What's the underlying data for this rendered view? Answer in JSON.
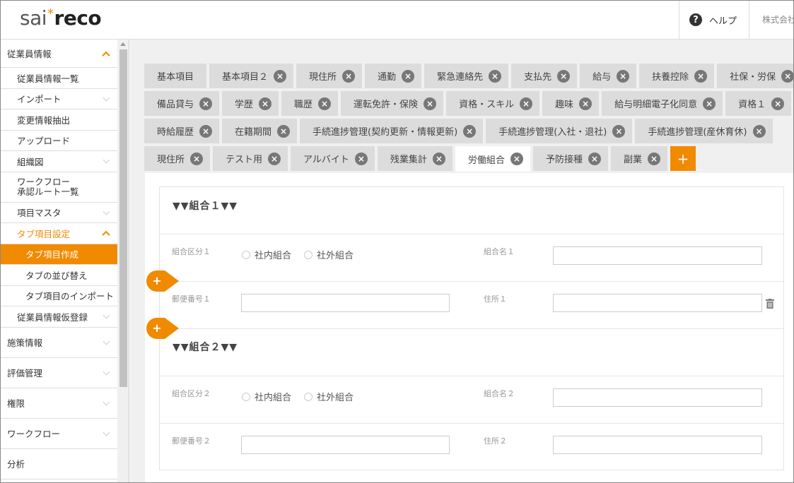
{
  "header": {
    "logo_a": "sai",
    "logo_star": "*",
    "logo_b": "reco",
    "help_icon": "question-icon",
    "help_label": "ヘルプ",
    "company": "株式会社"
  },
  "sidebar": {
    "items": [
      {
        "label": "従業員情報",
        "level": "top",
        "state": "open"
      },
      {
        "label": "従業員情報一覧",
        "level": "sub"
      },
      {
        "label": "インポート",
        "level": "sub",
        "chevron": true
      },
      {
        "label": "変更情報抽出",
        "level": "sub"
      },
      {
        "label": "アップロード",
        "level": "sub"
      },
      {
        "label": "組織図",
        "level": "sub",
        "chevron": true
      },
      {
        "label": "ワークフロー\n承認ルート一覧",
        "level": "sub"
      },
      {
        "label": "項目マスタ",
        "level": "sub",
        "chevron": true
      },
      {
        "label": "タブ項目設定",
        "level": "sub",
        "state": "open"
      },
      {
        "label": "タブ項目作成",
        "level": "sub2",
        "state": "active"
      },
      {
        "label": "タブの並び替え",
        "level": "sub2"
      },
      {
        "label": "タブ項目のインポート",
        "level": "sub2"
      },
      {
        "label": "従業員情報仮登録",
        "level": "sub",
        "chevron": true
      },
      {
        "label": "施策情報",
        "level": "top",
        "chevron": true
      },
      {
        "label": "評価管理",
        "level": "top",
        "chevron": true
      },
      {
        "label": "権限",
        "level": "top",
        "chevron": true
      },
      {
        "label": "ワークフロー",
        "level": "top",
        "chevron": true
      },
      {
        "label": "分析",
        "level": "top"
      }
    ]
  },
  "tabs": {
    "rows": [
      [
        {
          "label": "基本項目",
          "closable": false
        },
        {
          "label": "基本項目２",
          "closable": true
        },
        {
          "label": "現住所",
          "closable": true
        },
        {
          "label": "通勤",
          "closable": true
        },
        {
          "label": "緊急連絡先",
          "closable": true
        },
        {
          "label": "支払先",
          "closable": true
        },
        {
          "label": "給与",
          "closable": true
        },
        {
          "label": "扶養控除",
          "closable": true
        },
        {
          "label": "社保・労保",
          "closable": true
        }
      ],
      [
        {
          "label": "備品貸与",
          "closable": true
        },
        {
          "label": "学歴",
          "closable": true
        },
        {
          "label": "職歴",
          "closable": true
        },
        {
          "label": "運転免許・保険",
          "closable": true
        },
        {
          "label": "資格・スキル",
          "closable": true
        },
        {
          "label": "趣味",
          "closable": true
        },
        {
          "label": "給与明細電子化同意",
          "closable": true
        },
        {
          "label": "資格１",
          "closable": true
        }
      ],
      [
        {
          "label": "時給履歴",
          "closable": true
        },
        {
          "label": "在籍期間",
          "closable": true
        },
        {
          "label": "手続進捗管理(契約更新・情報更新)",
          "closable": true
        },
        {
          "label": "手続進捗管理(入社・退社)",
          "closable": true
        },
        {
          "label": "手続進捗管理(産休育休)",
          "closable": true
        }
      ],
      [
        {
          "label": "現住所",
          "closable": true
        },
        {
          "label": "テスト用",
          "closable": true
        },
        {
          "label": "アルバイト",
          "closable": true
        },
        {
          "label": "残業集計",
          "closable": true
        },
        {
          "label": "労働組合",
          "closable": true,
          "active": true
        },
        {
          "label": "予防接種",
          "closable": true
        },
        {
          "label": "副業",
          "closable": true
        }
      ]
    ],
    "close_glyph": "×",
    "add_glyph": "+"
  },
  "form": {
    "sections": [
      {
        "title": "▼▼組合１▼▼",
        "type_label": "組合区分１",
        "options": [
          "社内組合",
          "社外組合"
        ],
        "name_label": "組合名１",
        "name_value": "",
        "zip_label": "郵便番号１",
        "zip_value": "",
        "addr_label": "住所１",
        "addr_value": ""
      },
      {
        "title": "▼▼組合２▼▼",
        "type_label": "組合区分２",
        "options": [
          "社内組合",
          "社外組合"
        ],
        "name_label": "組合名２",
        "name_value": "",
        "zip_label": "郵便番号２",
        "zip_value": "",
        "addr_label": "住所２",
        "addr_value": ""
      }
    ],
    "insert_glyph": "+",
    "accent": "#f08a00"
  }
}
